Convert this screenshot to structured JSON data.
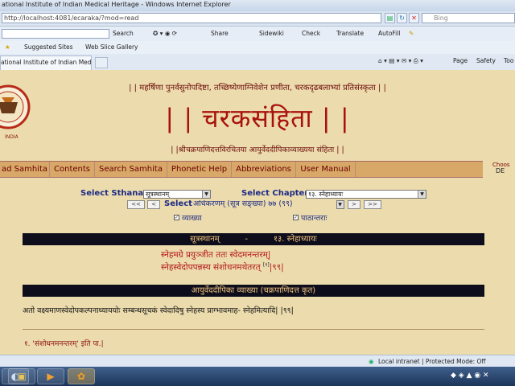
{
  "browser": {
    "title": "ational Institute of Indian Medical Heritage - Windows Internet Explorer",
    "address": "http://localhost:4081/ecaraka/?mod=read",
    "search_placeholder": "Bing",
    "toolbar": {
      "search": "Search",
      "share": "Share",
      "sidewiki": "Sidewiki",
      "check": "Check",
      "translate": "Translate",
      "autofill": "AutoFill"
    },
    "favorites": {
      "suggested": "Suggested Sites",
      "webslice": "Web Slice Gallery"
    },
    "tab_title": "ational Institute of Indian Medical ...",
    "command": {
      "page": "Page",
      "safety": "Safety",
      "tools": "Too"
    },
    "status": "Local intranet | Protected Mode: Off"
  },
  "page": {
    "logo_text": "INDIA",
    "invocation": "| | महर्षिणा पुनर्वसुनोपदिष्टा, तच्छिष्येणाग्निवेशेन प्रणीता, चरकदृढबलाभ्यां प्रतिसंस्कृता | |",
    "title": "| | चरकसंहिता | |",
    "subtitle": "| |श्रीचक्रपाणिदत्तविरचितया आयुर्वेददीपिकाव्याख्यया संहिता | |",
    "nav": [
      "ad Samhita",
      "Contents",
      "Search Samhita",
      "Phonetic Help",
      "Abbreviations",
      "User Manual"
    ],
    "choose_label": "Choos",
    "choose_value": "DE",
    "sthana_label": "Select Sthana",
    "sthana_value": "सूत्रस्थानम्",
    "chapter_label": "Select Chapter",
    "chapter_value": "१३. स्नेहाध्यायः",
    "adhikarana_label": "Select",
    "adhikarana_value": "अधिकरणम् (सूत्र सङ्ख्या)  ७७ (९९)",
    "nav_first": "<<",
    "nav_prev": "<",
    "nav_next": ">",
    "nav_last": ">>",
    "vyakhya_label": "व्याख्या",
    "pathantara_label": "पाठान्तराः",
    "section_bar": "सूत्रस्थानम्          -          १३. स्नेहाध्यायः",
    "verse_line1": "स्नेहमग्रे प्रयुञ्जीत ततः स्वेदमनन्तरम्|",
    "verse_line2": "स्नेहस्वेदोपपन्नस्य संशोधनमथेतरत् ",
    "verse_note": "[१]",
    "verse_end": "|९९|",
    "commentary_bar": "आयुर्वेददीपिका व्याख्या (चक्रपाणिदत्त कृत)",
    "commentary": "अतो वक्ष्यमाणस्वेदोपकल्पनाध्याययोः सम्बन्धसूचकं स्वेदादिषु स्नेहस्य प्राग्भावमाह- स्नेहमित्यादि| |९९|",
    "footnote": "१. 'संशोधनमनन्तरम्' इति पा.|"
  },
  "colors": {
    "title_red": "#a8120c",
    "bar_black": "#0d0d1c",
    "page_bg": "#ecdcad"
  }
}
